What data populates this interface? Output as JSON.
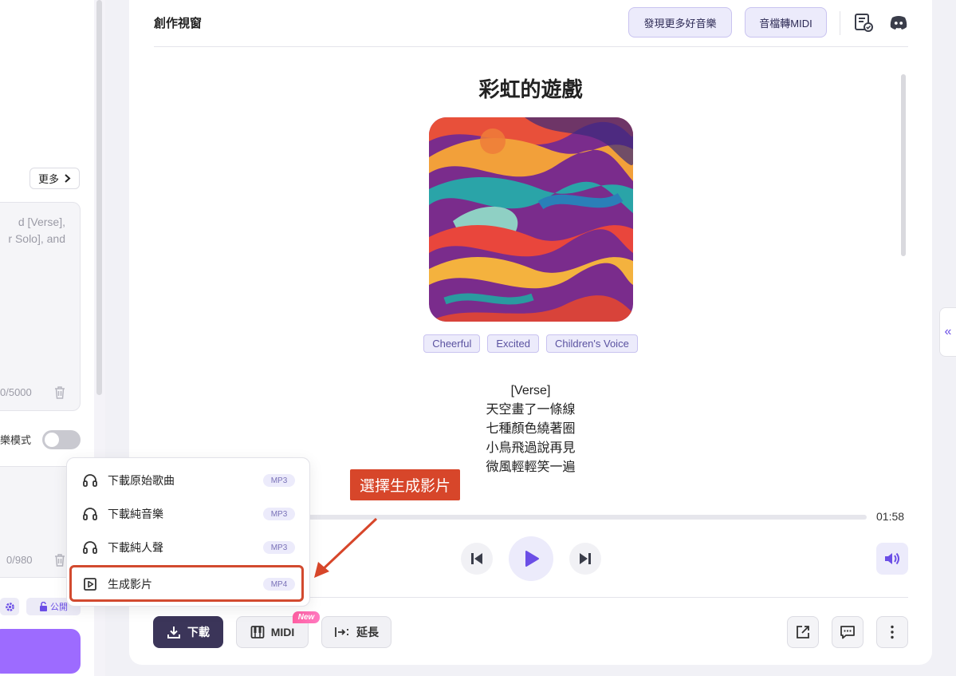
{
  "left": {
    "more_label": "更多",
    "lyrics_placeholder_line1": "d [Verse],",
    "lyrics_placeholder_line2": "r Solo], and",
    "lyrics_count": "0/5000",
    "mode_label": "樂模式",
    "style_count": "0/980",
    "public_label": "公開"
  },
  "header": {
    "title": "創作視窗",
    "discover_label": "發現更多好音樂",
    "midi_convert_label": "音檔轉MIDI"
  },
  "song": {
    "title": "彩虹的遊戲",
    "tags": [
      "Cheerful",
      "Excited",
      "Children's Voice"
    ],
    "lyrics": [
      "[Verse]",
      "天空畫了一條線",
      "七種顏色繞著圈",
      "小鳥飛過說再見",
      "微風輕輕笑一遍"
    ]
  },
  "player": {
    "duration": "01:58",
    "progress": 0
  },
  "actions": {
    "download_label": "下載",
    "midi_label": "MIDI",
    "new_badge": "New",
    "extend_label": "延長"
  },
  "dropdown": {
    "items": [
      {
        "label": "下載原始歌曲",
        "format": "MP3",
        "icon": "headphones-icon"
      },
      {
        "label": "下載純音樂",
        "format": "MP3",
        "icon": "headphones-icon"
      },
      {
        "label": "下載純人聲",
        "format": "MP3",
        "icon": "headphones-icon"
      },
      {
        "label": "生成影片",
        "format": "MP4",
        "icon": "video-play-icon"
      }
    ]
  },
  "annotation": {
    "callout": "選擇生成影片"
  },
  "colors": {
    "accent": "#6b4ee6",
    "annotation_red": "#d7462a",
    "download_button": "#3b3559"
  }
}
